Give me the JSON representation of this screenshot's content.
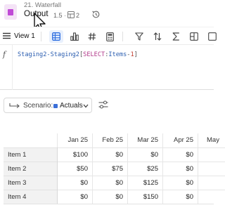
{
  "header": {
    "breadcrumb": "21. Waterfall",
    "title": "Output",
    "version": "1.5",
    "dot": "·",
    "grid_count": "2"
  },
  "toolbar": {
    "view_label": "View 1"
  },
  "formula": {
    "ref": "Staging2-Staging2",
    "open": "[",
    "keyword": "SELECT",
    "colon": ":",
    "items": "Items",
    "dash": "-",
    "number": "1",
    "close": "]"
  },
  "scenario": {
    "label": "Scenario:",
    "value": "Actuals",
    "color": "#3b6fd8"
  },
  "grid": {
    "columns": [
      "Jan 25",
      "Feb 25",
      "Mar 25",
      "Apr 25",
      "May"
    ],
    "rows": [
      {
        "label": "Item 1",
        "values": [
          "$100",
          "$0",
          "$0",
          "$0",
          ""
        ]
      },
      {
        "label": "Item 2",
        "values": [
          "$50",
          "$75",
          "$25",
          "$0",
          ""
        ]
      },
      {
        "label": "Item 3",
        "values": [
          "$0",
          "$0",
          "$125",
          "$0",
          ""
        ]
      },
      {
        "label": "Item 4",
        "values": [
          "$0",
          "$0",
          "$150",
          "$0",
          ""
        ]
      }
    ]
  }
}
